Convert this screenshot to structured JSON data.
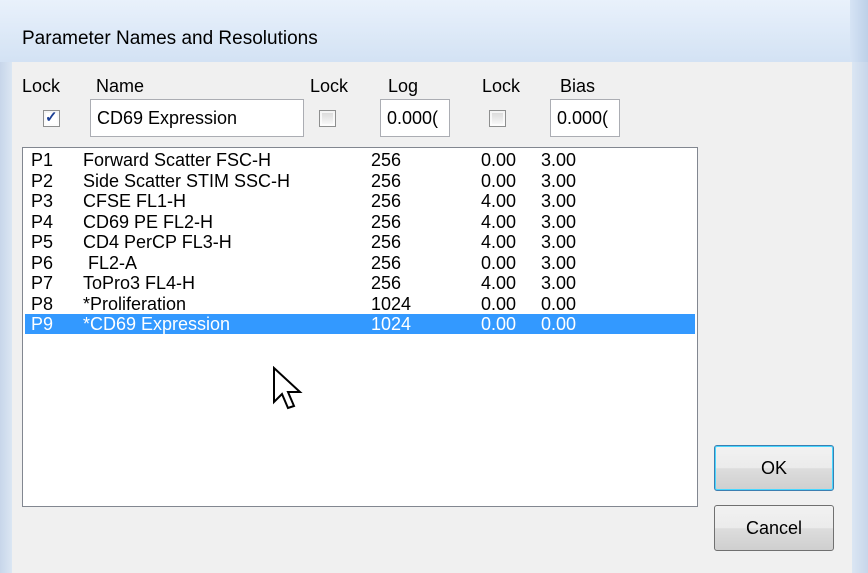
{
  "window": {
    "title": "Parameter Names and Resolutions"
  },
  "headers": {
    "lock1": "Lock",
    "name": "Name",
    "lock2": "Lock",
    "log": "Log",
    "lock3": "Lock",
    "bias": "Bias"
  },
  "controls": {
    "lock_name_checked": true,
    "name_value": "CD69 Expression",
    "lock_log_checked": false,
    "log_value": "0.000(",
    "lock_bias_checked": false,
    "bias_value": "0.000("
  },
  "parameters": [
    {
      "id": "P1",
      "name": "Forward Scatter FSC-H",
      "resolution": "256",
      "log": "0.00",
      "bias": "3.00"
    },
    {
      "id": "P2",
      "name": "Side Scatter STIM SSC-H",
      "resolution": "256",
      "log": "0.00",
      "bias": "3.00"
    },
    {
      "id": "P3",
      "name": "CFSE FL1-H",
      "resolution": "256",
      "log": "4.00",
      "bias": "3.00"
    },
    {
      "id": "P4",
      "name": "CD69 PE FL2-H",
      "resolution": "256",
      "log": "4.00",
      "bias": "3.00"
    },
    {
      "id": "P5",
      "name": "CD4 PerCP FL3-H",
      "resolution": "256",
      "log": "4.00",
      "bias": "3.00"
    },
    {
      "id": "P6",
      "name": " FL2-A",
      "resolution": "256",
      "log": "0.00",
      "bias": "3.00"
    },
    {
      "id": "P7",
      "name": "ToPro3 FL4-H",
      "resolution": "256",
      "log": "4.00",
      "bias": "3.00"
    },
    {
      "id": "P8",
      "name": "*Proliferation",
      "resolution": "1024",
      "log": "0.00",
      "bias": "0.00"
    },
    {
      "id": "P9",
      "name": "*CD69 Expression",
      "resolution": "1024",
      "log": "0.00",
      "bias": "0.00"
    }
  ],
  "selected_index": 8,
  "buttons": {
    "ok": "OK",
    "cancel": "Cancel"
  },
  "colors": {
    "selection": "#3399ff",
    "checkmark": "#1c3f94"
  }
}
